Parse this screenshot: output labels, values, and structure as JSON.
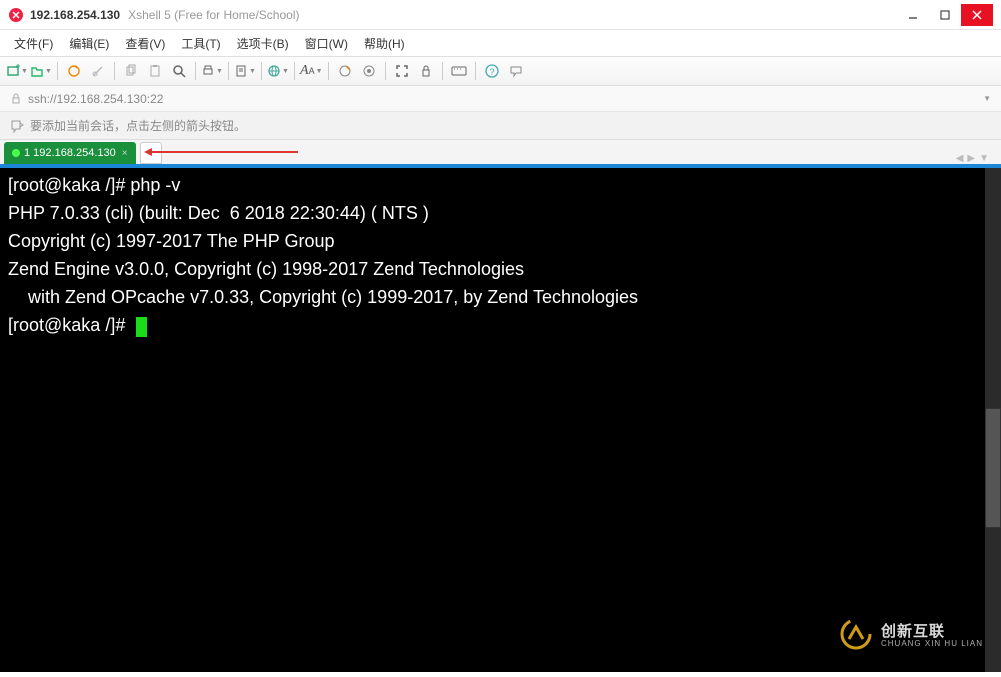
{
  "titlebar": {
    "host": "192.168.254.130",
    "app": "Xshell 5 (Free for Home/School)"
  },
  "menu": {
    "file": "文件(F)",
    "edit": "编辑(E)",
    "view": "查看(V)",
    "tools": "工具(T)",
    "tabs": "选项卡(B)",
    "window": "窗口(W)",
    "help": "帮助(H)"
  },
  "addressbar": {
    "url": "ssh://192.168.254.130:22"
  },
  "hint": {
    "text": "要添加当前会话，点击左侧的箭头按钮。"
  },
  "tabs": {
    "active": "1 192.168.254.130",
    "add": "+"
  },
  "terminal": {
    "prompt1_user": "[root@kaka /]#",
    "cmd1": " php -v",
    "line1": "PHP 7.0.33 (cli) (built: Dec  6 2018 22:30:44) ( NTS )",
    "line2": "Copyright (c) 1997-2017 The PHP Group",
    "line3": "Zend Engine v3.0.0, Copyright (c) 1998-2017 Zend Technologies",
    "line4": "    with Zend OPcache v7.0.33, Copyright (c) 1999-2017, by Zend Technologies",
    "prompt2_user": "[root@kaka /]#"
  },
  "watermark": {
    "brand": "创新互联",
    "sub": "CHUANG XIN HU LIAN"
  }
}
